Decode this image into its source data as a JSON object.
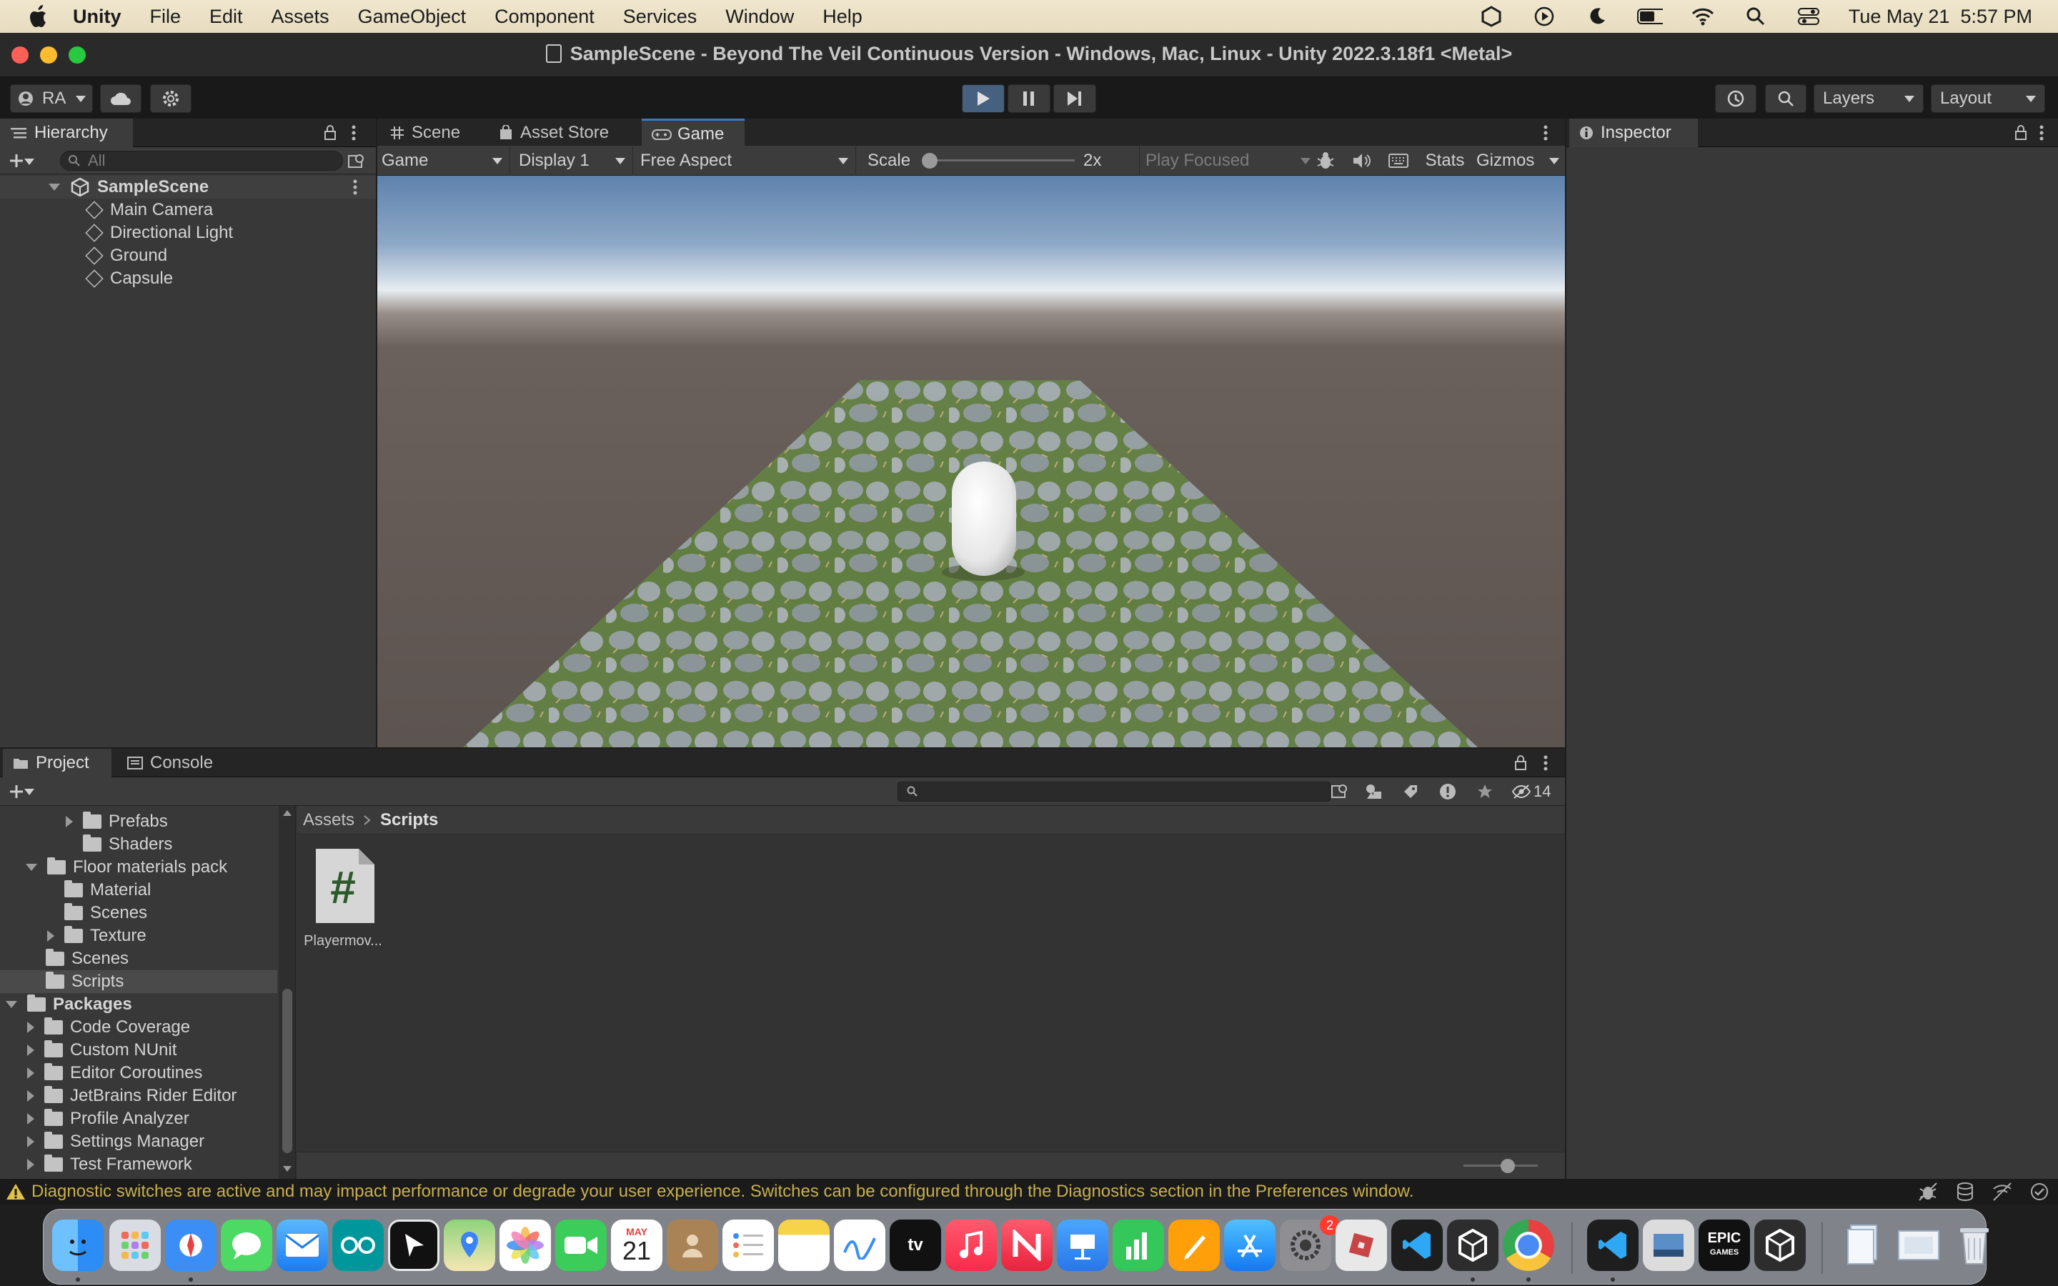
{
  "menubar": {
    "app_name": "Unity",
    "items": [
      "File",
      "Edit",
      "Assets",
      "GameObject",
      "Component",
      "Services",
      "Window",
      "Help"
    ],
    "clock": "Tue May 21  5:57 PM"
  },
  "window": {
    "title": "SampleScene - Beyond The Veil Continuous Version - Windows, Mac, Linux - Unity 2022.3.18f1 <Metal>"
  },
  "toolbar": {
    "account": "RA",
    "layers_label": "Layers",
    "layout_label": "Layout"
  },
  "hierarchy": {
    "tab_label": "Hierarchy",
    "search_placeholder": "All",
    "scene_name": "SampleScene",
    "objects": [
      "Main Camera",
      "Directional Light",
      "Ground",
      "Capsule"
    ]
  },
  "center_tabs": {
    "scene": "Scene",
    "asset_store": "Asset Store",
    "game": "Game"
  },
  "game_toolbar": {
    "view_mode": "Game",
    "display": "Display 1",
    "aspect": "Free Aspect",
    "scale_label": "Scale",
    "scale_value": "2x",
    "play_mode": "Play Focused",
    "stats": "Stats",
    "gizmos": "Gizmos"
  },
  "inspector": {
    "tab_label": "Inspector"
  },
  "bottom_tabs": {
    "project": "Project",
    "console": "Console"
  },
  "project": {
    "hidden_count": "14",
    "breadcrumb": [
      "Assets",
      "Scripts"
    ],
    "tree": [
      {
        "label": "Prefabs",
        "indent": 2,
        "arrow": "right"
      },
      {
        "label": "Shaders",
        "indent": 2,
        "arrow": ""
      },
      {
        "label": "Floor materials pack",
        "indent": 1,
        "arrow": "down"
      },
      {
        "label": "Material",
        "indent": 2,
        "arrow": ""
      },
      {
        "label": "Scenes",
        "indent": 2,
        "arrow": ""
      },
      {
        "label": "Texture",
        "indent": 2,
        "arrow": "right"
      },
      {
        "label": "Scenes",
        "indent": 1,
        "arrow": ""
      },
      {
        "label": "Scripts",
        "indent": 1,
        "arrow": "",
        "selected": true
      },
      {
        "label": "Packages",
        "indent": 0,
        "arrow": "down",
        "bold": true
      },
      {
        "label": "Code Coverage",
        "indent": 1,
        "arrow": "right"
      },
      {
        "label": "Custom NUnit",
        "indent": 1,
        "arrow": "right"
      },
      {
        "label": "Editor Coroutines",
        "indent": 1,
        "arrow": "right"
      },
      {
        "label": "JetBrains Rider Editor",
        "indent": 1,
        "arrow": "right"
      },
      {
        "label": "Profile Analyzer",
        "indent": 1,
        "arrow": "right"
      },
      {
        "label": "Settings Manager",
        "indent": 1,
        "arrow": "right"
      },
      {
        "label": "Test Framework",
        "indent": 1,
        "arrow": "right"
      }
    ],
    "asset_name": "Playermov..."
  },
  "statusbar": {
    "message": "Diagnostic switches are active and may impact performance or degrade your user experience. Switches can be configured through the Diagnostics section in the Preferences window."
  },
  "dock": {
    "calendar_month": "MAY",
    "calendar_day": "21",
    "notification_badge": "2",
    "epic_label": "EPIC",
    "epic_sub": "GAMES",
    "tv_label": "tv"
  },
  "colors": {
    "accent": "#3a79bb",
    "play_active": "#46607f",
    "warning": "#c9b04a"
  }
}
